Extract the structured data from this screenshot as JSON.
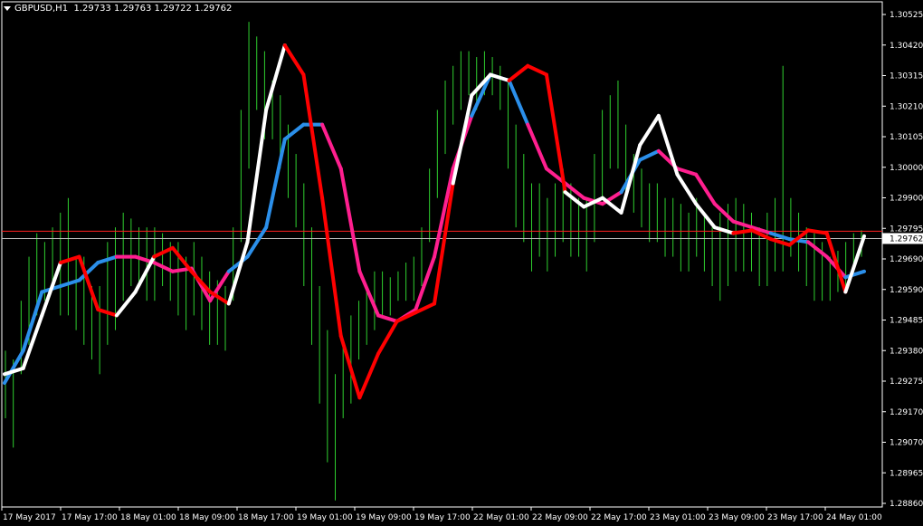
{
  "window": {
    "symbol_tf": "GBPUSD,H1",
    "ohlc": "1.29733 1.29763 1.29722 1.29762"
  },
  "colors": {
    "background": "#000000",
    "bars": "#2fcf2f",
    "fast_ma_up": "#ffffff",
    "fast_ma_down": "#ff0000",
    "slow_ma_up": "#2b8fea",
    "slow_ma_down": "#ff1f8f",
    "ask_line": "#ff2020",
    "bid_line": "#c0c0c0",
    "axis": "#ffffff"
  },
  "chart_data": {
    "type": "line",
    "price_axis": [
      "1.30525",
      "1.30420",
      "1.30315",
      "1.30210",
      "1.30105",
      "1.30000",
      "1.29900",
      "1.29795",
      "1.29690",
      "1.29590",
      "1.29485",
      "1.29380",
      "1.29275",
      "1.29170",
      "1.29070",
      "1.28965",
      "1.28860"
    ],
    "ylim": [
      1.2886,
      1.30525
    ],
    "time_axis": [
      "17 May 2017",
      "17 May 17:00",
      "18 May 01:00",
      "18 May 09:00",
      "18 May 17:00",
      "19 May 01:00",
      "19 May 09:00",
      "19 May 17:00",
      "22 May 01:00",
      "22 May 09:00",
      "22 May 17:00",
      "23 May 01:00",
      "23 May 09:00",
      "23 May 17:00",
      "24 May 01:00"
    ],
    "current_bid_label": "1.29762",
    "ask_level": 1.29787,
    "bid_level": 1.29762,
    "bars": [
      [
        1.2915,
        1.2938
      ],
      [
        1.2905,
        1.2935
      ],
      [
        1.293,
        1.2955
      ],
      [
        1.294,
        1.297
      ],
      [
        1.295,
        1.2978
      ],
      [
        1.2955,
        1.2975
      ],
      [
        1.296,
        1.298
      ],
      [
        1.295,
        1.2985
      ],
      [
        1.295,
        1.299
      ],
      [
        1.2945,
        1.297
      ],
      [
        1.294,
        1.297
      ],
      [
        1.2935,
        1.296
      ],
      [
        1.293,
        1.296
      ],
      [
        1.294,
        1.2975
      ],
      [
        1.2945,
        1.298
      ],
      [
        1.2955,
        1.2985
      ],
      [
        1.296,
        1.2983
      ],
      [
        1.296,
        1.298
      ],
      [
        1.2955,
        1.298
      ],
      [
        1.2955,
        1.298
      ],
      [
        1.296,
        1.2978
      ],
      [
        1.2955,
        1.2975
      ],
      [
        1.295,
        1.2975
      ],
      [
        1.2945,
        1.297
      ],
      [
        1.295,
        1.2975
      ],
      [
        1.2945,
        1.297
      ],
      [
        1.294,
        1.2965
      ],
      [
        1.294,
        1.2962
      ],
      [
        1.2938,
        1.296
      ],
      [
        1.2955,
        1.298
      ],
      [
        1.2975,
        1.302
      ],
      [
        1.3,
        1.305
      ],
      [
        1.302,
        1.3045
      ],
      [
        1.301,
        1.304
      ],
      [
        1.301,
        1.303
      ],
      [
        1.3,
        1.3025
      ],
      [
        1.299,
        1.3015
      ],
      [
        1.298,
        1.3005
      ],
      [
        1.296,
        1.2995
      ],
      [
        1.294,
        1.298
      ],
      [
        1.292,
        1.296
      ],
      [
        1.29,
        1.2945
      ],
      [
        1.2887,
        1.293
      ],
      [
        1.2915,
        1.294
      ],
      [
        1.292,
        1.295
      ],
      [
        1.2935,
        1.2955
      ],
      [
        1.294,
        1.296
      ],
      [
        1.2945,
        1.2965
      ],
      [
        1.295,
        1.2965
      ],
      [
        1.295,
        1.2963
      ],
      [
        1.2955,
        1.2965
      ],
      [
        1.2955,
        1.2968
      ],
      [
        1.2955,
        1.297
      ],
      [
        1.296,
        1.298
      ],
      [
        1.2975,
        1.3
      ],
      [
        1.299,
        1.302
      ],
      [
        1.3005,
        1.303
      ],
      [
        1.3015,
        1.3035
      ],
      [
        1.302,
        1.304
      ],
      [
        1.3025,
        1.304
      ],
      [
        1.302,
        1.3038
      ],
      [
        1.3025,
        1.304
      ],
      [
        1.3025,
        1.3038
      ],
      [
        1.302,
        1.3035
      ],
      [
        1.3,
        1.303
      ],
      [
        1.298,
        1.3015
      ],
      [
        1.2975,
        1.3005
      ],
      [
        1.2965,
        1.2995
      ],
      [
        1.297,
        1.2995
      ],
      [
        1.2965,
        1.299
      ],
      [
        1.297,
        1.2995
      ],
      [
        1.2975,
        1.3
      ],
      [
        1.297,
        1.2995
      ],
      [
        1.297,
        1.299
      ],
      [
        1.2965,
        1.299
      ],
      [
        1.2975,
        1.3005
      ],
      [
        1.299,
        1.302
      ],
      [
        1.3,
        1.3025
      ],
      [
        1.3,
        1.303
      ],
      [
        1.299,
        1.3015
      ],
      [
        1.2985,
        1.3005
      ],
      [
        1.298,
        1.3
      ],
      [
        1.2975,
        1.2995
      ],
      [
        1.2975,
        1.2995
      ],
      [
        1.297,
        1.299
      ],
      [
        1.297,
        1.299
      ],
      [
        1.2965,
        1.2988
      ],
      [
        1.2965,
        1.2985
      ],
      [
        1.297,
        1.299
      ],
      [
        1.2965,
        1.2985
      ],
      [
        1.296,
        1.298
      ],
      [
        1.2955,
        1.2985
      ],
      [
        1.296,
        1.2988
      ],
      [
        1.2965,
        1.299
      ],
      [
        1.2965,
        1.2988
      ],
      [
        1.2965,
        1.2985
      ],
      [
        1.296,
        1.298
      ],
      [
        1.296,
        1.2985
      ],
      [
        1.2965,
        1.299
      ],
      [
        1.2965,
        1.3035
      ],
      [
        1.297,
        1.299
      ],
      [
        1.2965,
        1.2985
      ],
      [
        1.296,
        1.298
      ],
      [
        1.2955,
        1.2978
      ],
      [
        1.2955,
        1.2975
      ],
      [
        1.2955,
        1.297
      ],
      [
        1.2958,
        1.2972
      ],
      [
        1.296,
        1.2975
      ],
      [
        1.2965,
        1.2978
      ],
      [
        1.297,
        1.2979
      ]
    ],
    "series": [
      {
        "trend": [
          "up",
          "up",
          "up",
          "up",
          "down",
          "down",
          "down",
          "up",
          "up",
          "down",
          "down",
          "down",
          "down",
          "up",
          "up",
          "up",
          "down",
          "down",
          "down",
          "down",
          "down",
          "down",
          "down",
          "down",
          "down",
          "up",
          "up",
          "up",
          "down",
          "down",
          "down",
          "up",
          "up",
          "up",
          "up",
          "up",
          "up",
          "up",
          "up",
          "up",
          "down",
          "down",
          "down",
          "down",
          "down",
          "down",
          "up"
        ],
        "values": [
          1.293,
          1.2932,
          1.295,
          1.2968,
          1.297,
          1.2952,
          1.295,
          1.2958,
          1.297,
          1.2973,
          1.2965,
          1.2958,
          1.2954,
          1.2975,
          1.302,
          1.3042,
          1.3032,
          1.299,
          1.2943,
          1.2922,
          1.2937,
          1.2948,
          1.2951,
          1.2954,
          1.2995,
          1.3025,
          1.3032,
          1.303,
          1.3035,
          1.3032,
          1.2992,
          1.2987,
          1.299,
          1.2985,
          1.3008,
          1.3018,
          1.2998,
          1.2988,
          1.298,
          1.2978,
          1.2979,
          1.2976,
          1.2974,
          1.2979,
          1.2978,
          1.2958,
          1.2977
        ]
      },
      {
        "trend": [
          "up",
          "up",
          "up",
          "up",
          "up",
          "up",
          "up",
          "down",
          "down",
          "down",
          "down",
          "down",
          "down",
          "up",
          "up",
          "up",
          "up",
          "up",
          "down",
          "down",
          "down",
          "down",
          "down",
          "down",
          "down",
          "down",
          "up",
          "up",
          "up",
          "down",
          "down",
          "down",
          "down",
          "down",
          "up",
          "up",
          "down",
          "down",
          "down",
          "down",
          "down",
          "down",
          "up",
          "up",
          "down",
          "down",
          "up"
        ],
        "values": [
          1.2927,
          1.2938,
          1.2958,
          1.296,
          1.2962,
          1.2968,
          1.297,
          1.297,
          1.2968,
          1.2965,
          1.2966,
          1.2955,
          1.2965,
          1.297,
          1.298,
          1.301,
          1.3015,
          1.3015,
          1.3,
          1.2965,
          1.295,
          1.2948,
          1.2952,
          1.297,
          1.3,
          1.3018,
          1.3032,
          1.303,
          1.3015,
          1.3,
          1.2995,
          1.299,
          1.2988,
          1.2992,
          1.3003,
          1.3006,
          1.3,
          1.2998,
          1.2988,
          1.2982,
          1.298,
          1.2978,
          1.2976,
          1.2975,
          1.297,
          1.2963,
          1.2965
        ]
      }
    ]
  }
}
